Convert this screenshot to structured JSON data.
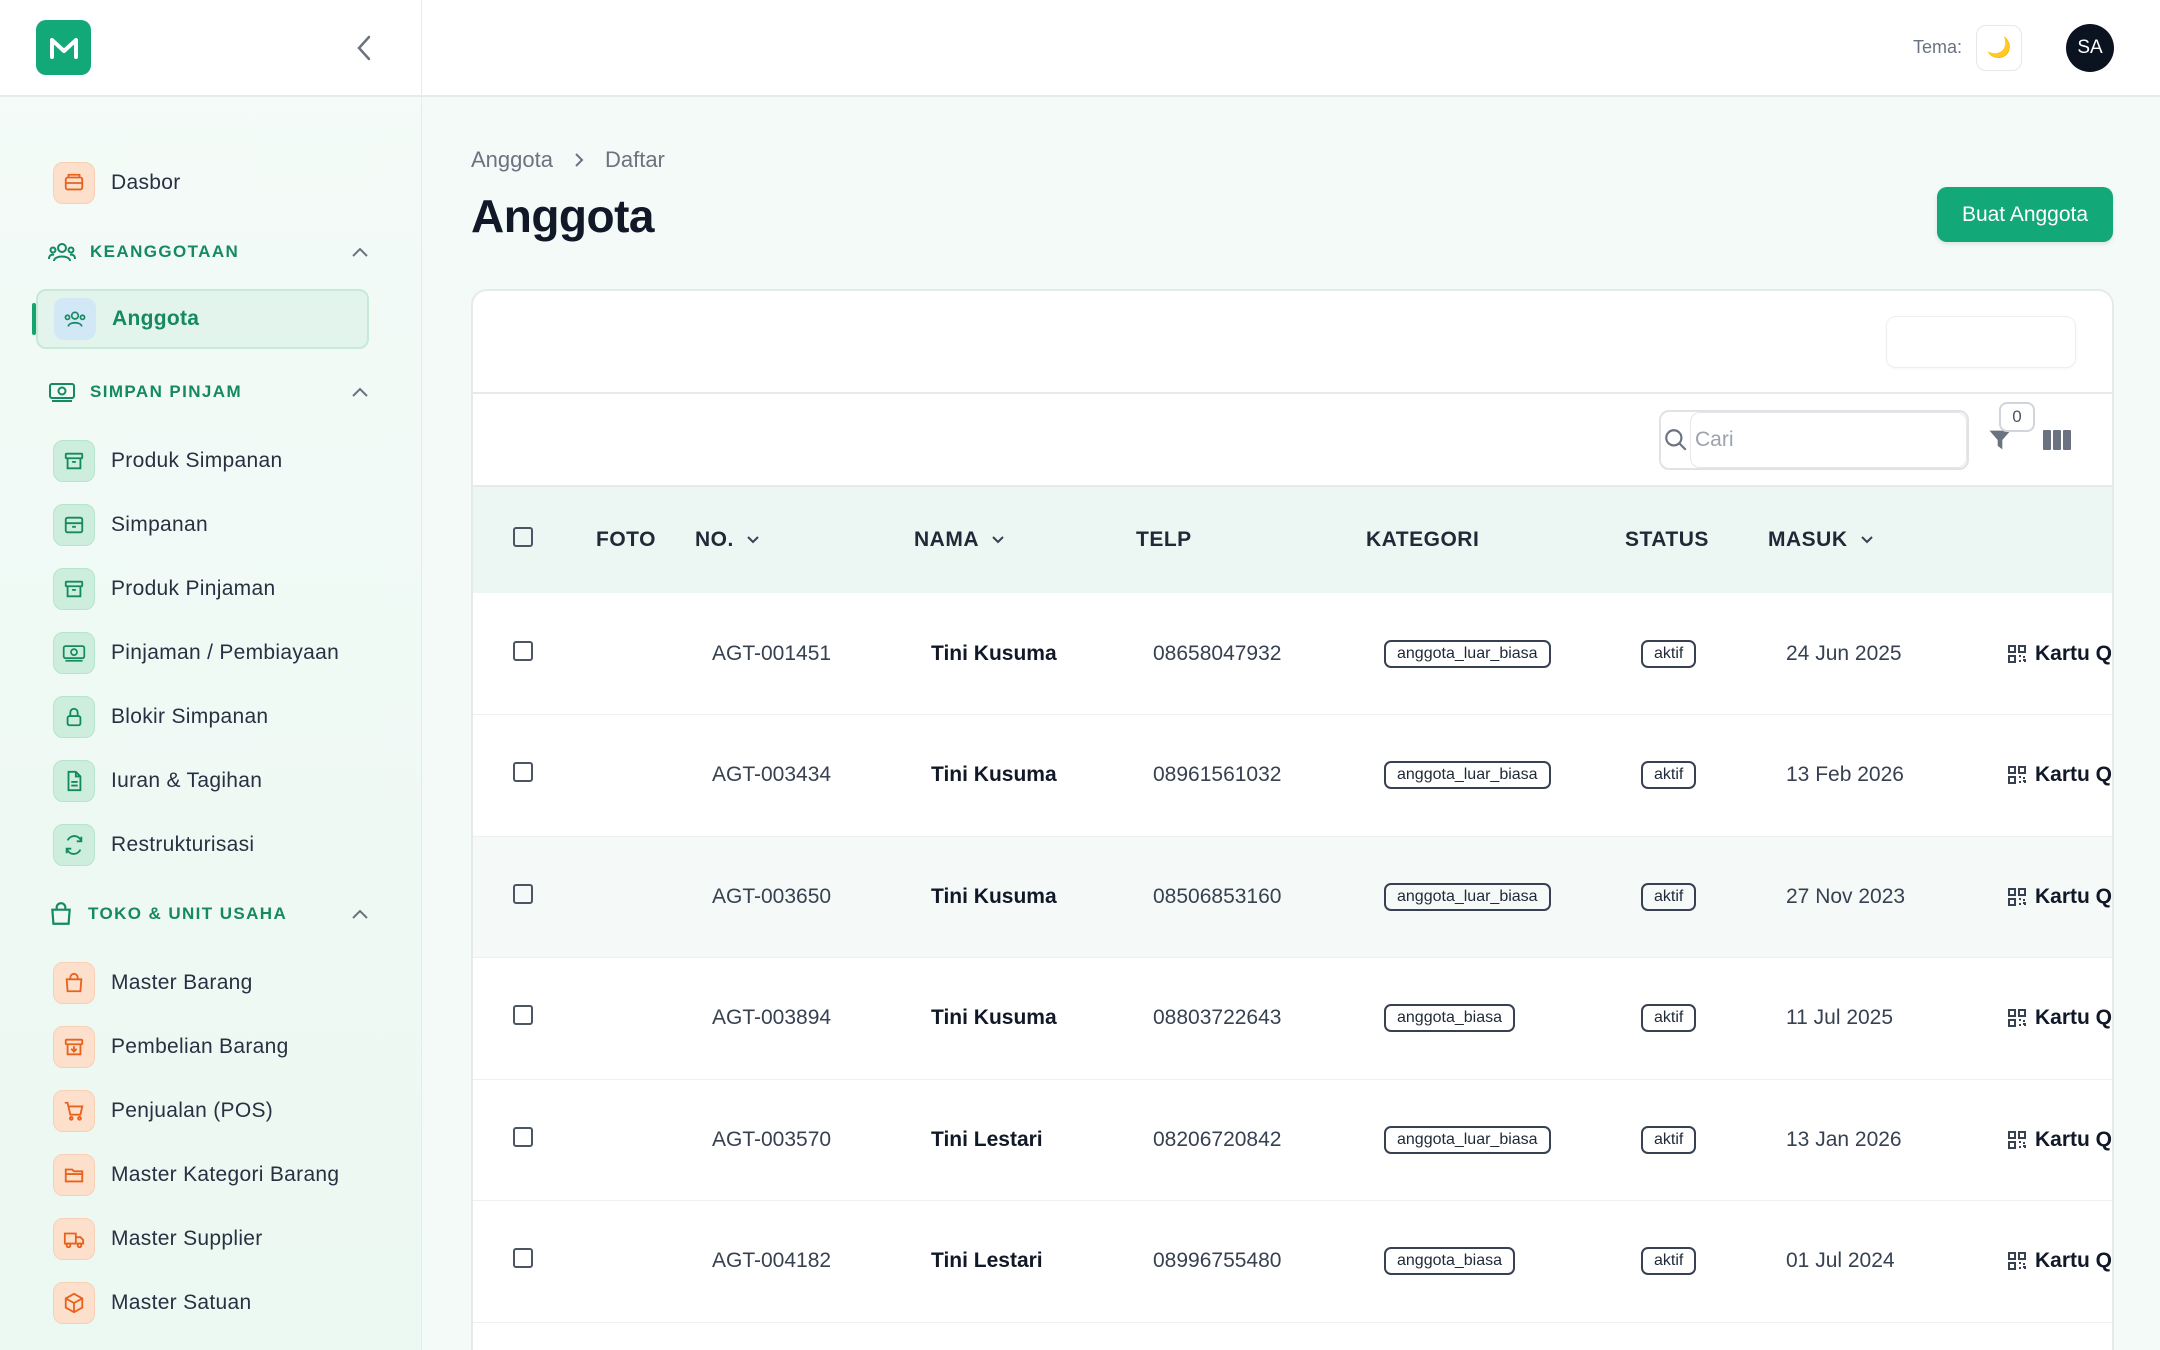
{
  "sidebar": {
    "items_top": [
      {
        "label": "Dasbor",
        "icon": "dashboard-icon"
      }
    ],
    "sections": [
      {
        "label": "KEANGGOTAAN",
        "icon": "members-icon",
        "items": [
          {
            "label": "Anggota",
            "icon": "members-icon",
            "active": true
          }
        ]
      },
      {
        "label": "SIMPAN PINJAM",
        "icon": "money-icon",
        "items": [
          {
            "label": "Produk Simpanan",
            "icon": "archive-icon"
          },
          {
            "label": "Simpanan",
            "icon": "box-icon"
          },
          {
            "label": "Produk Pinjaman",
            "icon": "archive-icon"
          },
          {
            "label": "Pinjaman / Pembiayaan",
            "icon": "money-icon"
          },
          {
            "label": "Blokir Simpanan",
            "icon": "lock-icon"
          },
          {
            "label": "Iuran & Tagihan",
            "icon": "document-icon"
          },
          {
            "label": "Restrukturisasi",
            "icon": "refresh-icon"
          }
        ]
      },
      {
        "label": "TOKO & UNIT USAHA",
        "icon": "bag-icon",
        "items": [
          {
            "label": "Master Barang",
            "icon": "bag-icon"
          },
          {
            "label": "Pembelian Barang",
            "icon": "download-box-icon"
          },
          {
            "label": "Penjualan (POS)",
            "icon": "cart-icon"
          },
          {
            "label": "Master Kategori Barang",
            "icon": "folder-icon"
          },
          {
            "label": "Master Supplier",
            "icon": "truck-icon"
          },
          {
            "label": "Master Satuan",
            "icon": "cube-icon"
          }
        ]
      }
    ]
  },
  "topbar": {
    "theme_label": "Tema:",
    "theme_icon": "moon-icon",
    "avatar_initials": "SA"
  },
  "breadcrumb": [
    "Anggota",
    "Daftar"
  ],
  "page_title": "Anggota",
  "create_button": "Buat Anggota",
  "search": {
    "placeholder": "Cari",
    "value": ""
  },
  "filter_count": "0",
  "table": {
    "columns": [
      "FOTO",
      "NO.",
      "NAMA",
      "TELP",
      "KATEGORI",
      "STATUS",
      "MASUK"
    ],
    "rows": [
      {
        "no": "AGT-001451",
        "nama": "Tini Kusuma",
        "telp": "08658047932",
        "kategori": "anggota_luar_biasa",
        "status": "aktif",
        "masuk": "24 Jun 2025",
        "action": "Kartu QR"
      },
      {
        "no": "AGT-003434",
        "nama": "Tini Kusuma",
        "telp": "08961561032",
        "kategori": "anggota_luar_biasa",
        "status": "aktif",
        "masuk": "13 Feb 2026",
        "action": "Kartu QR"
      },
      {
        "no": "AGT-003650",
        "nama": "Tini Kusuma",
        "telp": "08506853160",
        "kategori": "anggota_luar_biasa",
        "status": "aktif",
        "masuk": "27 Nov 2023",
        "action": "Kartu QR"
      },
      {
        "no": "AGT-003894",
        "nama": "Tini Kusuma",
        "telp": "08803722643",
        "kategori": "anggota_biasa",
        "status": "aktif",
        "masuk": "11 Jul 2025",
        "action": "Kartu QR"
      },
      {
        "no": "AGT-003570",
        "nama": "Tini Lestari",
        "telp": "08206720842",
        "kategori": "anggota_luar_biasa",
        "status": "aktif",
        "masuk": "13 Jan 2026",
        "action": "Kartu QR"
      },
      {
        "no": "AGT-004182",
        "nama": "Tini Lestari",
        "telp": "08996755480",
        "kategori": "anggota_biasa",
        "status": "aktif",
        "masuk": "01 Jul 2024",
        "action": "Kartu QR"
      }
    ]
  },
  "colors": {
    "accent": "#12a877",
    "accent_dark": "#15895f",
    "header_bg": "#ecf7f3"
  }
}
